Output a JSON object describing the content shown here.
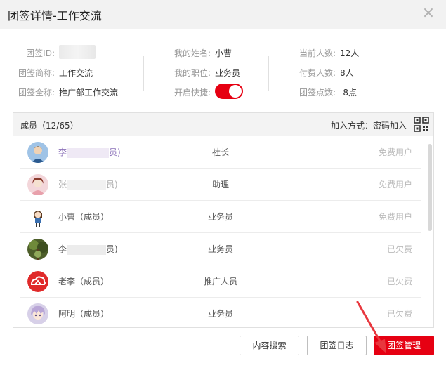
{
  "dialog": {
    "title": "团签详情-工作交流",
    "close_glyph": "×"
  },
  "info": {
    "col1": [
      {
        "label": "团签ID:",
        "value": ""
      },
      {
        "label": "团签简称:",
        "value": "工作交流"
      },
      {
        "label": "团签全称:",
        "value": "推广部工作交流"
      }
    ],
    "col2": [
      {
        "label": "我的姓名:",
        "value": "小曹"
      },
      {
        "label": "我的职位:",
        "value": "业务员"
      },
      {
        "label": "开启快捷:",
        "value": ""
      }
    ],
    "col3": [
      {
        "label": "当前人数:",
        "value": "12人"
      },
      {
        "label": "付费人数:",
        "value": "8人"
      },
      {
        "label": "团签点数:",
        "value": "-8点"
      }
    ],
    "quick_toggle_on": true
  },
  "members": {
    "count_label": "成员（12/65）",
    "join_method": "加入方式：密码加入",
    "list": [
      {
        "name": "李",
        "name_tail": "员)",
        "role": "社长",
        "status": "免费用户",
        "avatar": "avatar-photo-blue"
      },
      {
        "name": "张",
        "name_tail": "员)",
        "role": "助理",
        "status": "免费用户",
        "avatar": "avatar-photo-pink"
      },
      {
        "name": "小曹（成员）",
        "name_tail": "",
        "role": "业务员",
        "status": "免费用户",
        "avatar": "avatar-cartoon-girl"
      },
      {
        "name": "李",
        "name_tail": "员)",
        "role": "业务员",
        "status": "已欠费",
        "avatar": "avatar-photo-forest"
      },
      {
        "name": "老李（成员）",
        "name_tail": "",
        "role": "推广人员",
        "status": "已欠费",
        "avatar": "avatar-logo-red"
      },
      {
        "name": "阿明（成员）",
        "name_tail": "",
        "role": "业务员",
        "status": "已欠费",
        "avatar": "avatar-anime"
      }
    ]
  },
  "buttons": {
    "search": "内容搜索",
    "log": "团签日志",
    "manage": "团签管理"
  },
  "colors": {
    "accent": "#e60012",
    "annotation_arrow": "#e8373e"
  }
}
